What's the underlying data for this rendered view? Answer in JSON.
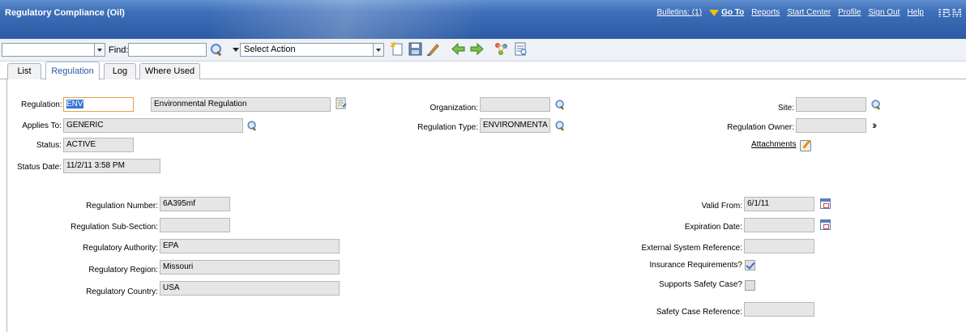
{
  "app": {
    "title": "Regulatory Compliance (Oil)",
    "bulletins": "Bulletins: (1)",
    "goto": "Go To",
    "nav": [
      "Reports",
      "Start Center",
      "Profile",
      "Sign Out",
      "Help"
    ],
    "brand": "IBM"
  },
  "toolbar": {
    "find_label": "Find:",
    "find_value": "",
    "query_value": "",
    "select_action": "Select Action",
    "icons": [
      "new-record-icon",
      "save-icon",
      "clear-changes-icon",
      "previous-record-icon",
      "next-record-icon",
      "workflow-icon",
      "view-history-icon"
    ]
  },
  "tabs": [
    {
      "label": "List",
      "active": false
    },
    {
      "label": "Regulation",
      "active": true
    },
    {
      "label": "Log",
      "active": false
    },
    {
      "label": "Where Used",
      "active": false
    }
  ],
  "form": {
    "regulation": {
      "label": "Regulation:",
      "code": "ENV",
      "description": "Environmental Regulation"
    },
    "applies_to": {
      "label": "Applies To:",
      "value": "GENERIC"
    },
    "status": {
      "label": "Status:",
      "value": "ACTIVE"
    },
    "status_date": {
      "label": "Status Date:",
      "value": "11/2/11 3:58 PM"
    },
    "organization": {
      "label": "Organization:",
      "value": ""
    },
    "regulation_type": {
      "label": "Regulation Type:",
      "value": "ENVIRONMENTA"
    },
    "site": {
      "label": "Site:",
      "value": ""
    },
    "regulation_owner": {
      "label": "Regulation Owner:",
      "value": ""
    },
    "attachments": "Attachments",
    "regulation_number": {
      "label": "Regulation Number:",
      "value": "6A395mf"
    },
    "regulation_sub_section": {
      "label": "Regulation Sub-Section:",
      "value": ""
    },
    "regulatory_authority": {
      "label": "Regulatory Authority:",
      "value": "EPA"
    },
    "regulatory_region": {
      "label": "Regulatory Region:",
      "value": "Missouri"
    },
    "regulatory_country": {
      "label": "Regulatory Country:",
      "value": "USA"
    },
    "valid_from": {
      "label": "Valid From:",
      "value": "6/1/11"
    },
    "expiration_date": {
      "label": "Expiration Date:",
      "value": ""
    },
    "external_system_reference": {
      "label": "External System Reference:",
      "value": ""
    },
    "insurance_requirements": {
      "label": "Insurance Requirements?",
      "checked": true
    },
    "supports_safety_case": {
      "label": "Supports Safety Case?",
      "checked": false
    },
    "safety_case_reference": {
      "label": "Safety Case Reference:",
      "value": ""
    }
  }
}
